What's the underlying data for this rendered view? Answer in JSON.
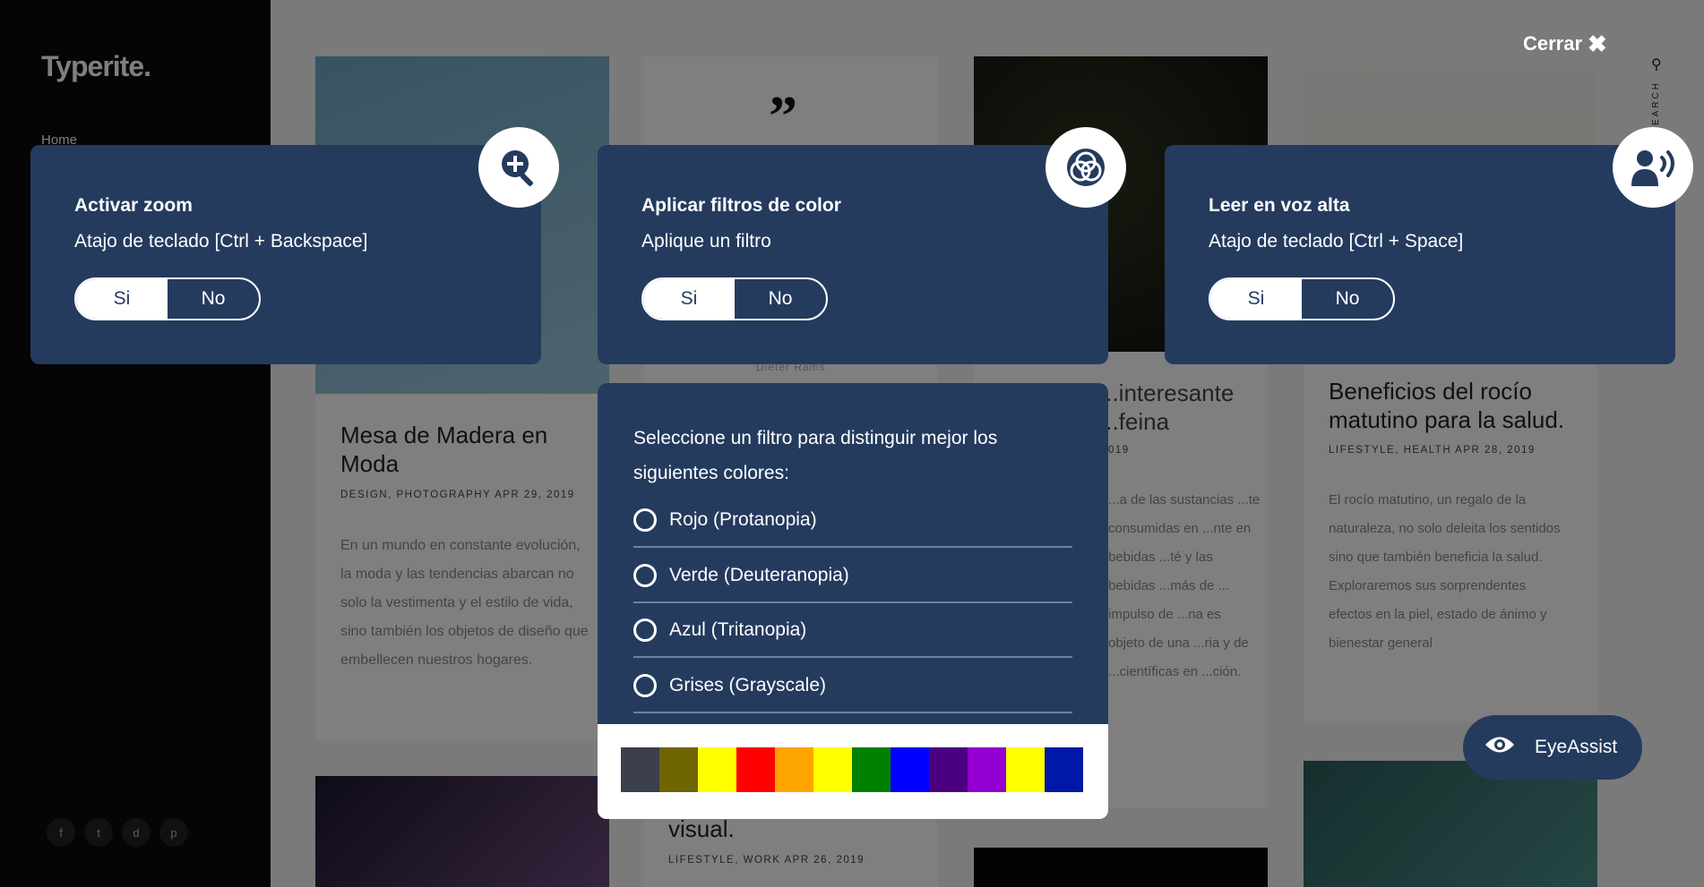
{
  "site": {
    "logo": "Typerite.",
    "nav_home": "Home",
    "search_label": "SEARCH",
    "socials": [
      "f",
      "t",
      "d",
      "p"
    ]
  },
  "posts": [
    {
      "title": "Mesa de Madera en Moda",
      "meta": "DESIGN, PHOTOGRAPHY  APR 29, 2019",
      "excerpt": "En un mundo en constante evolución, la moda y las tendencias abarcan no solo la vestimenta y el estilo de vida, sino también los objetos de diseño que embellecen nuestros hogares."
    },
    {
      "quote_mark": "”",
      "quote_author": "Dieter Rams",
      "title_fragment": "visual.",
      "meta": "LIFESTYLE, WORK  APR 26, 2019"
    },
    {
      "title_fragment": "...interesante ...feina",
      "meta_fragment": "019",
      "excerpt_fragment": "...a de las sustancias ...te consumidas en ...nte en bebidas ...té y las bebidas ...más de ... impulso de ...na es objeto de una ...ria y de ...científicas en ...ción."
    },
    {
      "title": "Beneficios del rocío matutino para la salud.",
      "meta": "LIFESTYLE, HEALTH  APR 28, 2019",
      "excerpt": "El rocío matutino, un regalo de la naturaleza, no solo deleita los sentidos sino que también beneficia la salud. Exploraremos sus sorprendentes efectos en la piel, estado de ánimo y bienestar general"
    }
  ],
  "overlay": {
    "close_label": "Cerrar",
    "panels": [
      {
        "title": "Activar zoom",
        "subtitle": "Atajo de teclado [Ctrl + Backspace]",
        "yes": "Si",
        "no": "No",
        "icon": "zoom-in-icon"
      },
      {
        "title": "Aplicar filtros de color",
        "subtitle": "Aplique un filtro",
        "yes": "Si",
        "no": "No",
        "icon": "color-filter-icon"
      },
      {
        "title": "Leer en voz alta",
        "subtitle": "Atajo de teclado [Ctrl + Space]",
        "yes": "Si",
        "no": "No",
        "icon": "speak-icon"
      }
    ],
    "filter": {
      "intro": "Seleccione un filtro para distinguir mejor los siguientes colores:",
      "options": [
        "Rojo (Protanopia)",
        "Verde (Deuteranopia)",
        "Azul (Tritanopia)",
        "Grises (Grayscale)"
      ],
      "palette": [
        "#3b3f4b",
        "#6e6400",
        "#ffff00",
        "#ff0000",
        "#ffa500",
        "#ffff00",
        "#008000",
        "#0000ff",
        "#4b0082",
        "#9400d3",
        "#ffff00",
        "#0018a8"
      ]
    },
    "eyeassist_label": "EyeAssist"
  },
  "colors": {
    "panel": "#243b5e",
    "overlay": "rgba(0,0,0,0.5)"
  }
}
